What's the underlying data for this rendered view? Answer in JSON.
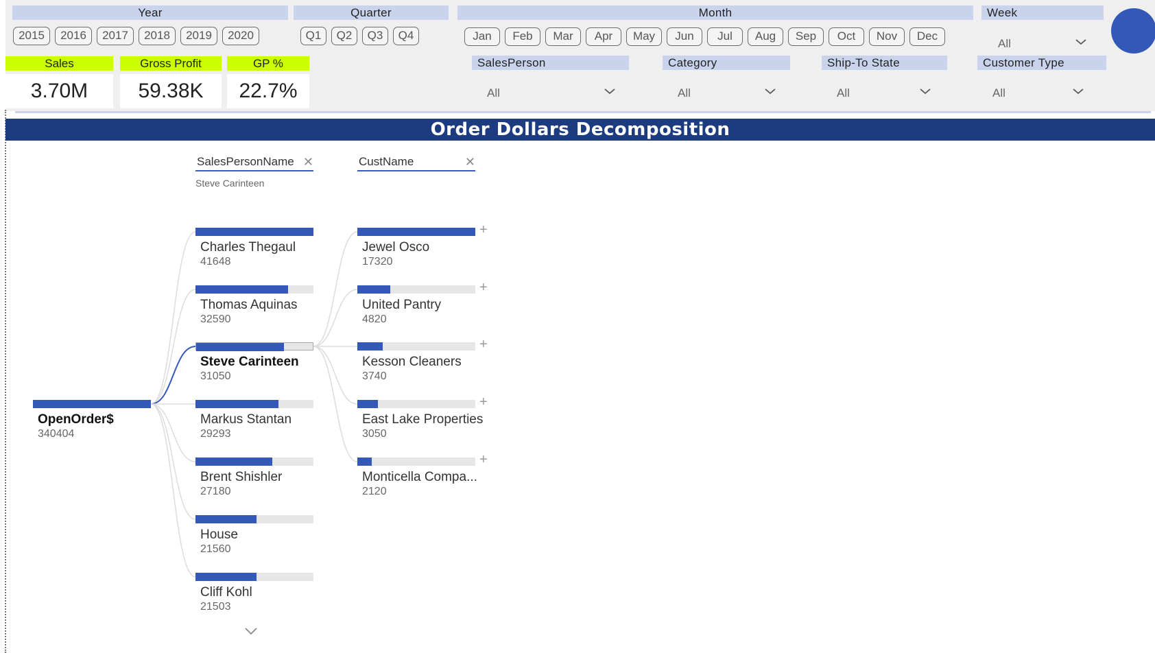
{
  "filters": {
    "year": {
      "header": "Year",
      "options": [
        "2015",
        "2016",
        "2017",
        "2018",
        "2019",
        "2020"
      ]
    },
    "quarter": {
      "header": "Quarter",
      "options": [
        "Q1",
        "Q2",
        "Q3",
        "Q4"
      ]
    },
    "month": {
      "header": "Month",
      "options": [
        "Jan",
        "Feb",
        "Mar",
        "Apr",
        "May",
        "Jun",
        "Jul",
        "Aug",
        "Sep",
        "Oct",
        "Nov",
        "Dec"
      ]
    },
    "week": {
      "header": "Week",
      "value": "All"
    },
    "salesperson": {
      "header": "SalesPerson",
      "value": "All"
    },
    "category": {
      "header": "Category",
      "value": "All"
    },
    "ship_to_state": {
      "header": "Ship-To State",
      "value": "All"
    },
    "customer_type": {
      "header": "Customer Type",
      "value": "All"
    }
  },
  "kpis": {
    "sales": {
      "label": "Sales",
      "value": "3.70M"
    },
    "gross_profit": {
      "label": "Gross Profit",
      "value": "59.38K"
    },
    "gp_pct": {
      "label": "GP %",
      "value": "22.7%"
    }
  },
  "colors": {
    "accent": "#3358b7",
    "kpi_header": "#ccff00",
    "slicer_header": "#c9d4ec",
    "title_bar": "#1d3b7f"
  },
  "visual": {
    "title": "Order Dollars Decomposition",
    "root": {
      "label": "OpenOrder$",
      "value": "340404"
    },
    "levels": [
      {
        "field": "SalesPersonName",
        "selected": "Steve Carinteen"
      },
      {
        "field": "CustName",
        "selected": ""
      }
    ],
    "salespeople": [
      {
        "label": "Charles Thegaul",
        "value": "41648",
        "fraction": 1.0
      },
      {
        "label": "Thomas Aquinas",
        "value": "32590",
        "fraction": 0.783
      },
      {
        "label": "Steve Carinteen",
        "value": "31050",
        "fraction": 0.746,
        "selected": true
      },
      {
        "label": "Markus Stantan",
        "value": "29293",
        "fraction": 0.703
      },
      {
        "label": "Brent Shishler",
        "value": "27180",
        "fraction": 0.653
      },
      {
        "label": "House",
        "value": "21560",
        "fraction": 0.518
      },
      {
        "label": "Cliff Kohl",
        "value": "21503",
        "fraction": 0.516
      }
    ],
    "customers": [
      {
        "label": "Jewel Osco",
        "value": "17320",
        "fraction": 1.0
      },
      {
        "label": "United Pantry",
        "value": "4820",
        "fraction": 0.278
      },
      {
        "label": "Kesson Cleaners",
        "value": "3740",
        "fraction": 0.216
      },
      {
        "label": "East Lake Properties",
        "value": "3050",
        "fraction": 0.176
      },
      {
        "label": "Monticella Compa...",
        "value": "2120",
        "fraction": 0.122
      }
    ],
    "icons": {
      "remove": "close-icon",
      "expand": "plus-icon",
      "more": "chevron-down-icon"
    }
  }
}
